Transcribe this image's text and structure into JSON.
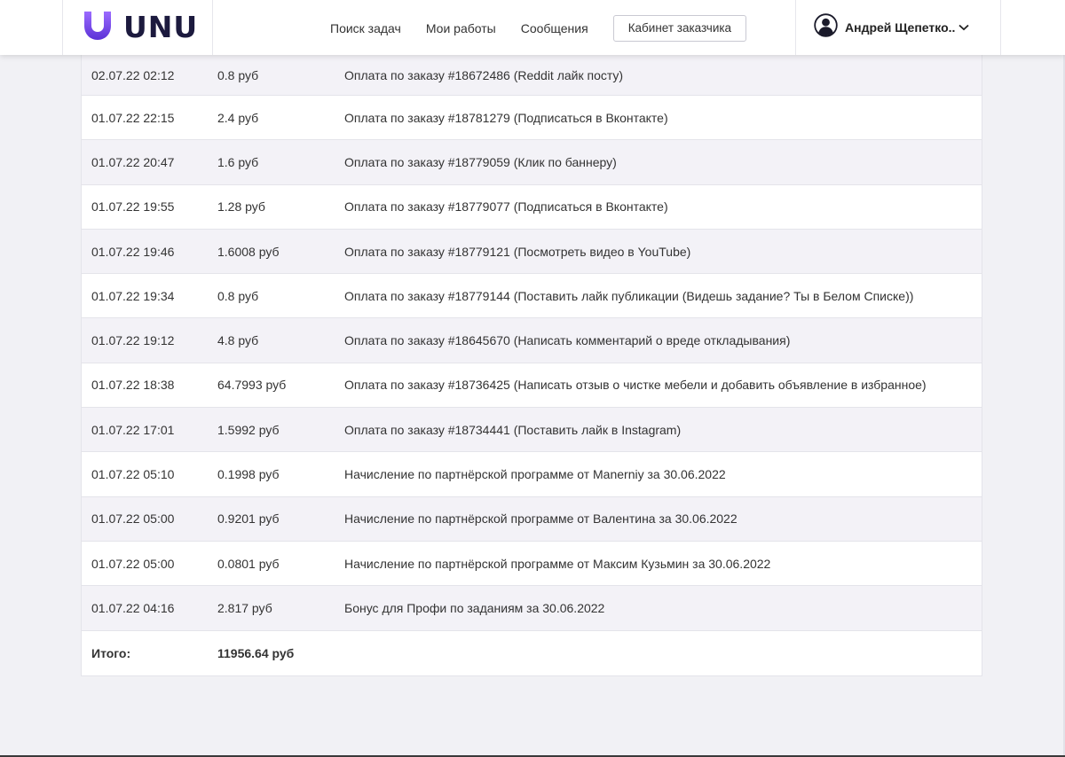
{
  "header": {
    "logo_text": "UNU",
    "nav": [
      {
        "label": "Поиск задач"
      },
      {
        "label": "Мои работы"
      },
      {
        "label": "Сообщения"
      }
    ],
    "customer_button": "Кабинет заказчика",
    "user_name": "Андрей Щепетко.."
  },
  "colors": {
    "brand_purple": "#7b4ee8",
    "logo_text": "#1c1a3e",
    "row_shaded": "#f3f2f7",
    "page_bg": "#f1f1f5"
  },
  "icons": {
    "logo": "unu-logo-icon",
    "avatar": "user-avatar-icon",
    "dropdown": "chevron-down-icon"
  },
  "transactions": [
    {
      "date": "02.07.22 02:12",
      "amount": "0.8 руб",
      "description": "Оплата по заказу #18672486 (Reddit лайк посту)"
    },
    {
      "date": "01.07.22 22:15",
      "amount": "2.4 руб",
      "description": "Оплата по заказу #18781279 (Подписаться в Вконтакте)"
    },
    {
      "date": "01.07.22 20:47",
      "amount": "1.6 руб",
      "description": "Оплата по заказу #18779059 (Клик по баннеру)"
    },
    {
      "date": "01.07.22 19:55",
      "amount": "1.28 руб",
      "description": "Оплата по заказу #18779077 (Подписаться в Вконтакте)"
    },
    {
      "date": "01.07.22 19:46",
      "amount": "1.6008 руб",
      "description": "Оплата по заказу #18779121 (Посмотреть видео в YouTube)"
    },
    {
      "date": "01.07.22 19:34",
      "amount": "0.8 руб",
      "description": "Оплата по заказу #18779144 (Поставить лайк публикации (Видешь задание? Ты в Белом Списке))"
    },
    {
      "date": "01.07.22 19:12",
      "amount": "4.8 руб",
      "description": "Оплата по заказу #18645670 (Написать комментарий о вреде откладывания)"
    },
    {
      "date": "01.07.22 18:38",
      "amount": "64.7993 руб",
      "description": "Оплата по заказу #18736425 (Написать отзыв о чистке мебели и добавить объявление в избранное)"
    },
    {
      "date": "01.07.22 17:01",
      "amount": "1.5992 руб",
      "description": "Оплата по заказу #18734441 (Поставить лайк в Instagram)"
    },
    {
      "date": "01.07.22 05:10",
      "amount": "0.1998 руб",
      "description": "Начисление по партнёрской программе от Manerniy за 30.06.2022"
    },
    {
      "date": "01.07.22 05:00",
      "amount": "0.9201 руб",
      "description": "Начисление по партнёрской программе от Валентина за 30.06.2022"
    },
    {
      "date": "01.07.22 05:00",
      "amount": "0.0801 руб",
      "description": "Начисление по партнёрской программе от Максим Кузьмин за 30.06.2022"
    },
    {
      "date": "01.07.22 04:16",
      "amount": "2.817 руб",
      "description": "Бонус для Профи по заданиям за 30.06.2022"
    }
  ],
  "total": {
    "label": "Итого:",
    "amount": "11956.64 руб"
  }
}
